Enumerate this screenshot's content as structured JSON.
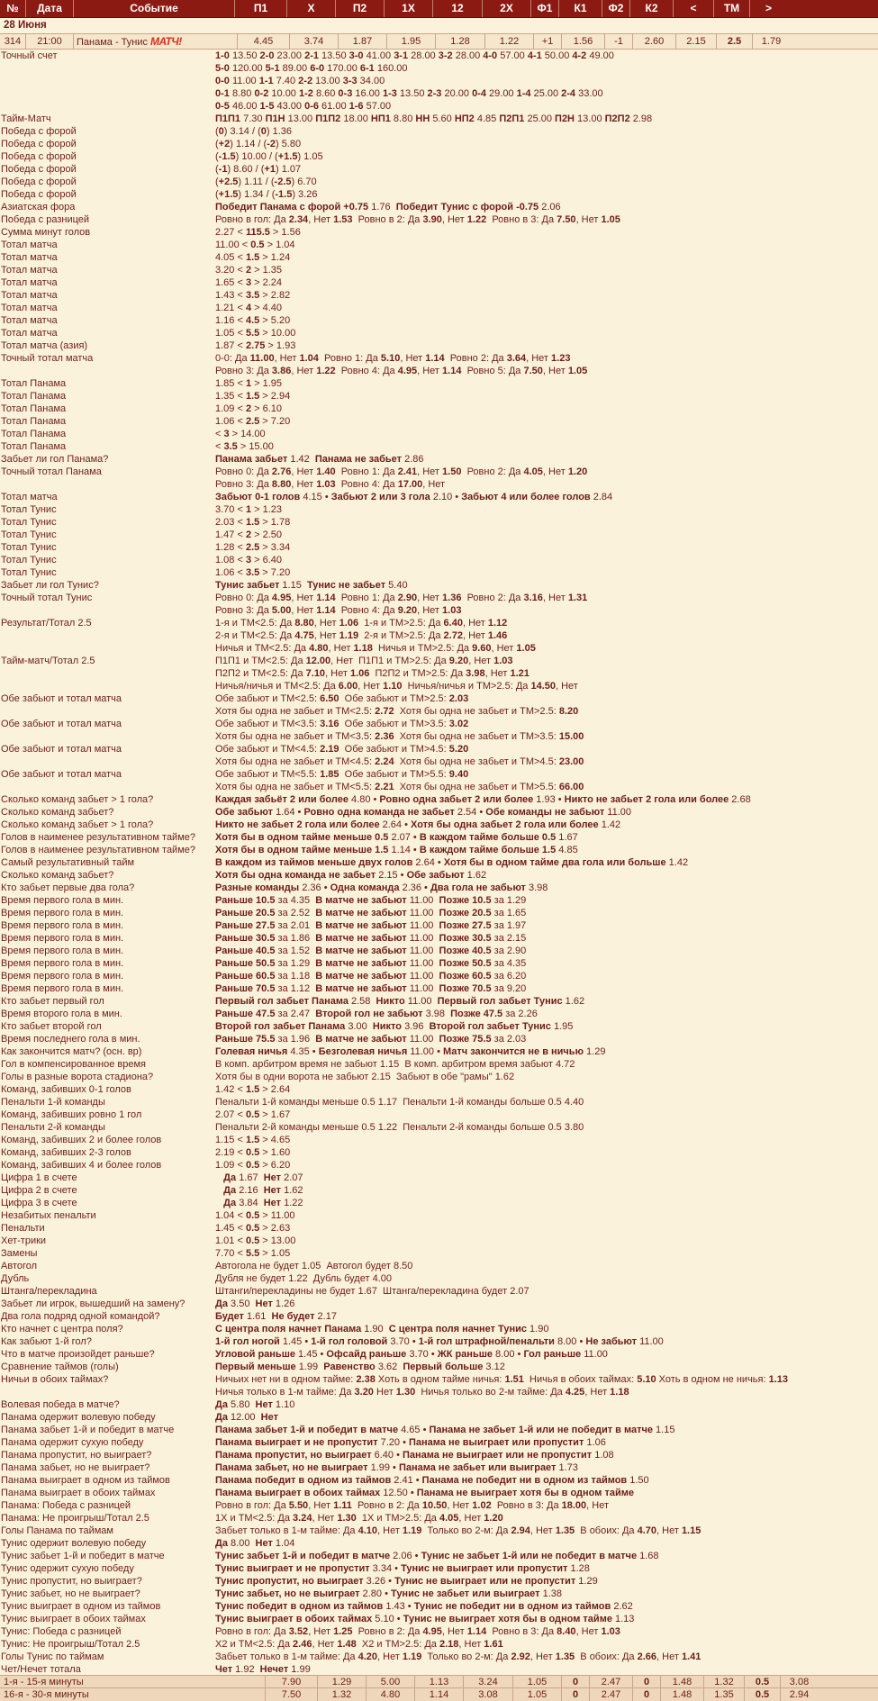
{
  "header": {
    "columns": [
      "№",
      "Дата",
      "Событие",
      "П1",
      "X",
      "П2",
      "1X",
      "12",
      "2X",
      "Ф1",
      "К1",
      "Ф2",
      "К2",
      "<",
      "ТМ",
      ">"
    ]
  },
  "date_label": "28 Июня",
  "event": {
    "cells": [
      "314",
      "21:00",
      "Панама - Тунис",
      "4.45",
      "3.74",
      "1.87",
      "1.95",
      "1.28",
      "1.22",
      "+1",
      "1.56",
      "-1",
      "2.60",
      "2.15",
      "2.5",
      "1.79"
    ],
    "broadcast": "МАТЧ!"
  },
  "markets": [
    {
      "label": "Точный счет",
      "lines": [
        "**1-0** 13.50 **2-0** 23.00 **2-1** 13.50 **3-0** 41.00 **3-1** 28.00 **3-2** 28.00 **4-0** 57.00 **4-1** 50.00 **4-2** 49.00",
        "**5-0** 120.00 **5-1** 89.00 **6-0** 170.00 **6-1** 160.00",
        "**0-0** 11.00 **1-1** 7.40 **2-2** 13.00 **3-3** 34.00",
        "**0-1** 8.80 **0-2** 10.00 **1-2** 8.60 **0-3** 16.00 **1-3** 13.50 **2-3** 20.00 **0-4** 29.00 **1-4** 25.00 **2-4** 33.00",
        "**0-5** 46.00 **1-5** 43.00 **0-6** 61.00 **1-6** 57.00"
      ]
    },
    {
      "label": "Тайм-Матч",
      "lines": [
        "**П1П1** 7.30 **П1Н** 13.00 **П1П2** 18.00 **НП1** 8.80 **НН** 5.60 **НП2** 4.85 **П2П1** 25.00 **П2Н** 13.00 **П2П2** 2.98"
      ]
    },
    {
      "label": "Победа с форой",
      "lines": [
        "(**0**) 3.14 / (**0**) 1.36"
      ]
    },
    {
      "label": "Победа с форой",
      "lines": [
        "(**+2**) 1.14 / (**-2**) 5.80"
      ]
    },
    {
      "label": "Победа с форой",
      "lines": [
        "(**-1.5**) 10.00 / (**+1.5**) 1.05"
      ]
    },
    {
      "label": "Победа с форой",
      "lines": [
        "(**-1**) 8.60 / (**+1**) 1.07"
      ]
    },
    {
      "label": "Победа с форой",
      "lines": [
        "(**+2.5**) 1.11 / (**-2.5**) 6.70"
      ]
    },
    {
      "label": "Победа с форой",
      "lines": [
        "(**+1.5**) 1.34 / (**-1.5**) 3.26"
      ]
    },
    {
      "label": "Азиатская фора",
      "lines": [
        "**Победит Панама с форой +0.75** 1.76  **Победит Тунис с форой -0.75** 2.06"
      ]
    },
    {
      "label": "Победа с разницей",
      "lines": [
        "Ровно в гол: Да **2.34**, Нет **1.53**  Ровно в 2: Да **3.90**, Нет **1.22**  Ровно в 3: Да **7.50**, Нет **1.05**"
      ]
    },
    {
      "label": "Сумма минут голов",
      "lines": [
        "2.27 < **115.5** > 1.56"
      ]
    },
    {
      "label": "Тотал матча",
      "lines": [
        "11.00 < **0.5** > 1.04"
      ]
    },
    {
      "label": "Тотал матча",
      "lines": [
        "4.05 < **1.5** > 1.24"
      ]
    },
    {
      "label": "Тотал матча",
      "lines": [
        "3.20 < **2** > 1.35"
      ]
    },
    {
      "label": "Тотал матча",
      "lines": [
        "1.65 < **3** > 2.24"
      ]
    },
    {
      "label": "Тотал матча",
      "lines": [
        "1.43 < **3.5** > 2.82"
      ]
    },
    {
      "label": "Тотал матча",
      "lines": [
        "1.21 < **4** > 4.40"
      ]
    },
    {
      "label": "Тотал матча",
      "lines": [
        "1.16 < **4.5** > 5.20"
      ]
    },
    {
      "label": "Тотал матча",
      "lines": [
        "1.05 < **5.5** > 10.00"
      ]
    },
    {
      "label": "Тотал матча (азия)",
      "lines": [
        "1.87 < **2.75** > 1.93"
      ]
    },
    {
      "label": "Точный тотал матча",
      "lines": [
        "0-0: Да **11.00**, Нет **1.04**  Ровно 1: Да **5.10**, Нет **1.14**  Ровно 2: Да **3.64**, Нет **1.23**",
        "Ровно 3: Да **3.86**, Нет **1.22**  Ровно 4: Да **4.95**, Нет **1.14**  Ровно 5: Да **7.50**, Нет **1.05**"
      ]
    },
    {
      "label": "Тотал Панама",
      "lines": [
        "1.85 < **1** > 1.95"
      ]
    },
    {
      "label": "Тотал Панама",
      "lines": [
        "1.35 < **1.5** > 2.94"
      ]
    },
    {
      "label": "Тотал Панама",
      "lines": [
        "1.09 < **2** > 6.10"
      ]
    },
    {
      "label": "Тотал Панама",
      "lines": [
        "1.06 < **2.5** > 7.20"
      ]
    },
    {
      "label": "Тотал Панама",
      "lines": [
        "< **3** > 14.00"
      ]
    },
    {
      "label": "Тотал Панама",
      "lines": [
        "< **3.5** > 15.00"
      ]
    },
    {
      "label": "Забьет ли гол Панама?",
      "lines": [
        "**Панама забьет** 1.42  **Панама не забьет** 2.86"
      ]
    },
    {
      "label": "Точный тотал Панама",
      "lines": [
        "Ровно 0: Да **2.76**, Нет **1.40**  Ровно 1: Да **2.41**, Нет **1.50**  Ровно 2: Да **4.05**, Нет **1.20**",
        "Ровно 3: Да **8.80**, Нет **1.03**  Ровно 4: Да **17.00**, Нет"
      ]
    },
    {
      "label": "Тотал матча",
      "lines": [
        "**Забьют 0-1 голов** 4.15 • **Забьют 2 или 3 гола** 2.10 • **Забьют 4 или более голов** 2.84"
      ]
    },
    {
      "label": "Тотал Тунис",
      "lines": [
        "3.70 < **1** > 1.23"
      ]
    },
    {
      "label": "Тотал Тунис",
      "lines": [
        "2.03 < **1.5** > 1.78"
      ]
    },
    {
      "label": "Тотал Тунис",
      "lines": [
        "1.47 < **2** > 2.50"
      ]
    },
    {
      "label": "Тотал Тунис",
      "lines": [
        "1.28 < **2.5** > 3.34"
      ]
    },
    {
      "label": "Тотал Тунис",
      "lines": [
        "1.08 < **3** > 6.40"
      ]
    },
    {
      "label": "Тотал Тунис",
      "lines": [
        "1.06 < **3.5** > 7.20"
      ]
    },
    {
      "label": "Забьет ли гол Тунис?",
      "lines": [
        "**Тунис забьет** 1.15  **Тунис не забьет** 5.40"
      ]
    },
    {
      "label": "Точный тотал Тунис",
      "lines": [
        "Ровно 0: Да **4.95**, Нет **1.14**  Ровно 1: Да **2.90**, Нет **1.36**  Ровно 2: Да **3.16**, Нет **1.31**",
        "Ровно 3: Да **5.00**, Нет **1.14**  Ровно 4: Да **9.20**, Нет **1.03**"
      ]
    },
    {
      "label": "Результат/Тотал 2.5",
      "lines": [
        "1-я и ТМ<2.5: Да **8.80**, Нет **1.06**  1-я и ТМ>2.5: Да **6.40**, Нет **1.12**",
        "2-я и ТМ<2.5: Да **4.75**, Нет **1.19**  2-я и ТМ>2.5: Да **2.72**, Нет **1.46**",
        "Ничья и ТМ<2.5: Да **4.80**, Нет **1.18**  Ничья и ТМ>2.5: Да **9.60**, Нет **1.05**"
      ]
    },
    {
      "label": "Тайм-матч/Тотал 2.5",
      "lines": [
        "П1П1 и ТМ<2.5: Да **12.00**, Нет  П1П1 и ТМ>2.5: Да **9.20**, Нет **1.03**",
        "П2П2 и ТМ<2.5: Да **7.10**, Нет **1.06**  П2П2 и ТМ>2.5: Да **3.98**, Нет **1.21**",
        "Ничья/ничья и ТМ<2.5: Да **6.00**, Нет **1.10**  Ничья/ничья и ТМ>2.5: Да **14.50**, Нет"
      ]
    },
    {
      "label": "Обе забьют и тотал матча",
      "lines": [
        "Обе забьют и ТМ<2.5: **6.50**  Обе забьют и ТМ>2.5: **2.03**",
        "Хотя бы одна не забьет и ТМ<2.5: **2.72**  Хотя бы одна не забьет и ТМ>2.5: **8.20**"
      ]
    },
    {
      "label": "Обе забьют и тотал матча",
      "lines": [
        "Обе забьют и ТМ<3.5: **3.16**  Обе забьют и ТМ>3.5: **3.02**",
        "Хотя бы одна не забьет и ТМ<3.5: **2.36**  Хотя бы одна не забьет и ТМ>3.5: **15.00**"
      ]
    },
    {
      "label": "Обе забьют и тотал матча",
      "lines": [
        "Обе забьют и ТМ<4.5: **2.19**  Обе забьют и ТМ>4.5: **5.20**",
        "Хотя бы одна не забьет и ТМ<4.5: **2.24**  Хотя бы одна не забьет и ТМ>4.5: **23.00**"
      ]
    },
    {
      "label": "Обе забьют и тотал матча",
      "lines": [
        "Обе забьют и ТМ<5.5: **1.85**  Обе забьют и ТМ>5.5: **9.40**",
        "Хотя бы одна не забьет и ТМ<5.5: **2.21**  Хотя бы одна не забьет и ТМ>5.5: **66.00**"
      ]
    },
    {
      "label": "Сколько команд забьет > 1 гола?",
      "lines": [
        "**Каждая забьёт 2 или более** 4.80 • **Ровно одна забьет 2 или более** 1.93 • **Никто не забьет 2 гола или более** 2.68"
      ]
    },
    {
      "label": "Сколько команд забьет?",
      "lines": [
        "**Обе забьют** 1.64 • **Ровно одна команда не забьет** 2.54 • **Обе команды не забьют** 11.00"
      ]
    },
    {
      "label": "Сколько команд забьет > 1 гола?",
      "lines": [
        "**Никто не забьет 2 гола или более** 2.64 • **Хотя бы одна забьет 2 гола или более** 1.42"
      ]
    },
    {
      "label": "Голов в наименее результативном тайме?",
      "lines": [
        "**Хотя бы в одном тайме меньше 0.5** 2.07 • **В каждом тайме больше 0.5** 1.67"
      ]
    },
    {
      "label": "Голов в наименее результативном тайме?",
      "lines": [
        "**Хотя бы в одном тайме меньше 1.5** 1.14 • **В каждом тайме больше 1.5** 4.85"
      ]
    },
    {
      "label": "Самый результативный тайм",
      "lines": [
        "**В каждом из таймов меньше двух голов** 2.64 • **Хотя бы в одном тайме два гола или больше** 1.42"
      ]
    },
    {
      "label": "Сколько команд забьет?",
      "lines": [
        "**Хотя бы одна команда не забьет** 2.15 • **Обе забьют** 1.62"
      ]
    },
    {
      "label": "Кто забьет первые два гола?",
      "lines": [
        "**Разные команды** 2.36 • **Одна команда** 2.36 • **Два гола не забьют** 3.98"
      ]
    },
    {
      "label": "Время первого гола в мин.",
      "lines": [
        "**Раньше 10.5** за 4.35  **В матче не забьют** 11.00  **Позже 10.5** за 1.29"
      ]
    },
    {
      "label": "Время первого гола в мин.",
      "lines": [
        "**Раньше 20.5** за 2.52  **В матче не забьют** 11.00  **Позже 20.5** за 1.65"
      ]
    },
    {
      "label": "Время первого гола в мин.",
      "lines": [
        "**Раньше 27.5** за 2.01  **В матче не забьют** 11.00  **Позже 27.5** за 1.97"
      ]
    },
    {
      "label": "Время первого гола в мин.",
      "lines": [
        "**Раньше 30.5** за 1.86  **В матче не забьют** 11.00  **Позже 30.5** за 2.15"
      ]
    },
    {
      "label": "Время первого гола в мин.",
      "lines": [
        "**Раньше 40.5** за 1.52  **В матче не забьют** 11.00  **Позже 40.5** за 2.90"
      ]
    },
    {
      "label": "Время первого гола в мин.",
      "lines": [
        "**Раньше 50.5** за 1.29  **В матче не забьют** 11.00  **Позже 50.5** за 4.35"
      ]
    },
    {
      "label": "Время первого гола в мин.",
      "lines": [
        "**Раньше 60.5** за 1.18  **В матче не забьют** 11.00  **Позже 60.5** за 6.20"
      ]
    },
    {
      "label": "Время первого гола в мин.",
      "lines": [
        "**Раньше 70.5** за 1.12  **В матче не забьют** 11.00  **Позже 70.5** за 9.20"
      ]
    },
    {
      "label": "Кто забьет первый гол",
      "lines": [
        "**Первый гол забьет Панама** 2.58  **Никто** 11.00  **Первый гол забьет Тунис** 1.62"
      ]
    },
    {
      "label": "Время второго гола в мин.",
      "lines": [
        "**Раньше 47.5** за 2.47  **Второй гол не забьют** 3.98  **Позже 47.5** за 2.26"
      ]
    },
    {
      "label": "Кто забьет второй гол",
      "lines": [
        "**Второй гол забьет Панама** 3.00  **Никто** 3.96  **Второй гол забьет Тунис** 1.95"
      ]
    },
    {
      "label": "Время последнего гола в мин.",
      "lines": [
        "**Раньше 75.5** за 1.96  **В матче не забьют** 11.00  **Позже 75.5** за 2.03"
      ]
    },
    {
      "label": "Как закончится матч? (осн. вр)",
      "lines": [
        "**Голевая ничья** 4.35 • **Безголевая ничья** 11.00 • **Матч закончится не в ничью** 1.29"
      ]
    },
    {
      "label": "Гол в компенсированное время",
      "lines": [
        "В комп. арбитром время не забьют 1.15  В комп. арбитром время забьют 4.72"
      ]
    },
    {
      "label": "Голы в разные ворота стадиона?",
      "lines": [
        "Хотя бы в одни ворота не забьют 2.15  Забьют в обе \"рамы\" 1.62"
      ]
    },
    {
      "label": "Команд, забивших 0-1 голов",
      "lines": [
        "1.42 < **1.5** > 2.64"
      ]
    },
    {
      "label": "Пенальти 1-й команды",
      "lines": [
        "Пенальти 1-й команды меньше 0.5 1.17  Пенальти 1-й команды больше 0.5 4.40"
      ]
    },
    {
      "label": "Команд, забивших ровно 1 гол",
      "lines": [
        "2.07 < **0.5** > 1.67"
      ]
    },
    {
      "label": "Пенальти 2-й команды",
      "lines": [
        "Пенальти 2-й команды меньше 0.5 1.22  Пенальти 2-й команды больше 0.5 3.80"
      ]
    },
    {
      "label": "Команд, забивших 2 и более голов",
      "lines": [
        "1.15 < **1.5** > 4.65"
      ]
    },
    {
      "label": "Команд, забивших 2-3 голов",
      "lines": [
        "2.19 < **0.5** > 1.60"
      ]
    },
    {
      "label": "Команд, забивших 4 и более голов",
      "lines": [
        "1.09 < **0.5** > 6.20"
      ]
    },
    {
      "label": "Цифра 1 в счете",
      "lines": [
        "   **Да** 1.67  **Нет** 2.07"
      ]
    },
    {
      "label": "Цифра 2 в счете",
      "lines": [
        "   **Да** 2.16  **Нет** 1.62"
      ]
    },
    {
      "label": "Цифра 3 в счете",
      "lines": [
        "   **Да** 3.84  **Нет** 1.22"
      ]
    },
    {
      "label": "Незабитых пенальти",
      "lines": [
        "1.04 < **0.5** > 11.00"
      ]
    },
    {
      "label": "Пенальти",
      "lines": [
        "1.45 < **0.5** > 2.63"
      ]
    },
    {
      "label": "Хет-трики",
      "lines": [
        "1.01 < **0.5** > 13.00"
      ]
    },
    {
      "label": "Замены",
      "lines": [
        "7.70 < **5.5** > 1.05"
      ]
    },
    {
      "label": "Автогол",
      "lines": [
        "Автогола не будет 1.05  Автогол будет 8.50"
      ]
    },
    {
      "label": "Дубль",
      "lines": [
        "Дубля не будет 1.22  Дубль будет 4.00"
      ]
    },
    {
      "label": "Штанга/перекладина",
      "lines": [
        "Штанги/перекладины не будет 1.67  Штанга/перекладина будет 2.07"
      ]
    },
    {
      "label": "Забьет ли игрок, вышедший на замену?",
      "lines": [
        "**Да** 3.50  **Нет** 1.26"
      ]
    },
    {
      "label": "Два гола подряд одной командой?",
      "lines": [
        "**Будет** 1.61  **Не будет** 2.17"
      ]
    },
    {
      "label": "Кто начнет с центра поля?",
      "lines": [
        "**С центра поля начнет Панама** 1.90  **С центра поля начнет Тунис** 1.90"
      ]
    },
    {
      "label": "Как забьют 1-й гол?",
      "lines": [
        "**1-й гол ногой** 1.45 • **1-й гол головой** 3.70 • **1-й гол штрафной/пенальти** 8.00 • **Не забьют** 11.00"
      ]
    },
    {
      "label": "Что в матче произойдет раньше?",
      "lines": [
        "**Угловой раньше** 1.45 • **Офсайд раньше** 3.70 • **ЖК раньше** 8.00 • **Гол раньше** 11.00"
      ]
    },
    {
      "label": "Сравнение таймов (голы)",
      "lines": [
        "**Первый меньше** 1.99  **Равенство** 3.62  **Первый больше** 3.12"
      ]
    },
    {
      "label": "Ничьи в обоих таймах?",
      "lines": [
        "Ничьих нет ни в одном тайме: **2.38** Хоть в одном тайме ничья: **1.51**  Ничья в обоих таймах: **5.10** Хоть в одном не ничья: **1.13**",
        "Ничья только в 1-м тайме: Да **3.20** Нет **1.30**  Ничья только во 2-м тайме: Да **4.25**, Нет **1.18**"
      ]
    },
    {
      "label": "Волевая победа в матче?",
      "lines": [
        "**Да** 5.80  **Нет** 1.10"
      ]
    },
    {
      "label": "Панама одержит волевую победу",
      "lines": [
        "**Да** 12.00  **Нет**"
      ]
    },
    {
      "label": "Панама забьет 1-й и победит в матче",
      "lines": [
        "**Панама забьет 1-й и победит в матче** 4.65 • **Панама не забьет 1-й или не победит в матче** 1.15"
      ]
    },
    {
      "label": "Панама одержит сухую победу",
      "lines": [
        "**Панама выиграет и не пропустит** 7.20 • **Панама не выиграет или пропустит** 1.06"
      ]
    },
    {
      "label": "Панама пропустит, но выиграет?",
      "lines": [
        "**Панама пропустит, но выиграет** 6.40 • **Панама не выиграет или не пропустит** 1.08"
      ]
    },
    {
      "label": "Панама забьет, но не выиграет?",
      "lines": [
        "**Панама забьет, но не выиграет** 1.99 • **Панама не забьет или выиграет** 1.73"
      ]
    },
    {
      "label": "Панама выиграет в одном из таймов",
      "lines": [
        "**Панама победит в одном из таймов** 2.41 • **Панама не победит ни в одном из таймов** 1.50"
      ]
    },
    {
      "label": "Панама выиграет в обоих таймах",
      "lines": [
        "**Панама выиграет в обоих таймах** 12.50 • **Панама не выиграет хотя бы в одном тайме**"
      ]
    },
    {
      "label": "Панама: Победа с разницей",
      "lines": [
        "Ровно в гол: Да **5.50**, Нет **1.11**  Ровно в 2: Да **10.50**, Нет **1.02**  Ровно в 3: Да **18.00**, Нет"
      ]
    },
    {
      "label": "Панама: Не проигрыш/Тотал 2.5",
      "lines": [
        "1X и ТМ<2.5: Да **3.24**, Нет **1.30**  1X и ТМ>2.5: Да **4.05**, Нет **1.20**"
      ]
    },
    {
      "label": "Голы Панама по таймам",
      "lines": [
        "Забьет только в 1-м тайме: Да **4.10**, Нет **1.19**  Только во 2-м: Да **2.94**, Нет **1.35**  В обоих: Да **4.70**, Нет **1.15**"
      ]
    },
    {
      "label": "Тунис одержит волевую победу",
      "lines": [
        "**Да** 8.00  **Нет** 1.04"
      ]
    },
    {
      "label": "Тунис забьет 1-й и победит в матче",
      "lines": [
        "**Тунис забьет 1-й и победит в матче** 2.06 • **Тунис не забьет 1-й или не победит в матче** 1.68"
      ]
    },
    {
      "label": "Тунис одержит сухую победу",
      "lines": [
        "**Тунис выиграет и не пропустит** 3.34 • **Тунис не выиграет или пропустит** 1.28"
      ]
    },
    {
      "label": "Тунис пропустит, но выиграет?",
      "lines": [
        "**Тунис пропустит, но выиграет** 3.26 • **Тунис не выиграет или не пропустит** 1.29"
      ]
    },
    {
      "label": "Тунис забьет, но не выиграет?",
      "lines": [
        "**Тунис забьет, но не выиграет** 2.80 • **Тунис не забьет или выиграет** 1.38"
      ]
    },
    {
      "label": "Тунис выиграет в одном из таймов",
      "lines": [
        "**Тунис победит в одном из таймов** 1.43 • **Тунис не победит ни в одном из таймов** 2.62"
      ]
    },
    {
      "label": "Тунис выиграет в обоих таймах",
      "lines": [
        "**Тунис выиграет в обоих таймах** 5.10 • **Тунис не выиграет хотя бы в одном тайме** 1.13"
      ]
    },
    {
      "label": "Тунис: Победа с разницей",
      "lines": [
        "Ровно в гол: Да **3.52**, Нет **1.25**  Ровно в 2: Да **4.95**, Нет **1.14**  Ровно в 3: Да **8.40**, Нет **1.03**"
      ]
    },
    {
      "label": "Тунис: Не проигрыш/Тотал 2.5",
      "lines": [
        "X2 и ТМ<2.5: Да **2.46**, Нет **1.48**  X2 и ТМ>2.5: Да **2.18**, Нет **1.61**"
      ]
    },
    {
      "label": "Голы Тунис по таймам",
      "lines": [
        "Забьет только в 1-м тайме: Да **4.20**, Нет **1.19**  Только во 2-м: Да **2.92**, Нет **1.35**  В обоих: Да **2.66**, Нет **1.41**"
      ]
    },
    {
      "label": "Чет/Нечет тотала",
      "lines": [
        "**Чет** 1.92  **Нечет** 1.99"
      ]
    }
  ],
  "footer_rows": [
    {
      "cells": [
        "1-я - 15-я минуты",
        "7.90",
        "1.29",
        "5.00",
        "1.13",
        "3.24",
        "1.05",
        "0",
        "2.47",
        "0",
        "1.48",
        "1.32",
        "0.5",
        "3.08"
      ]
    },
    {
      "cells": [
        "16-я - 30-я минуты",
        "7.50",
        "1.32",
        "4.80",
        "1.14",
        "3.08",
        "1.05",
        "0",
        "2.47",
        "0",
        "1.48",
        "1.35",
        "0.5",
        "2.94"
      ]
    }
  ]
}
